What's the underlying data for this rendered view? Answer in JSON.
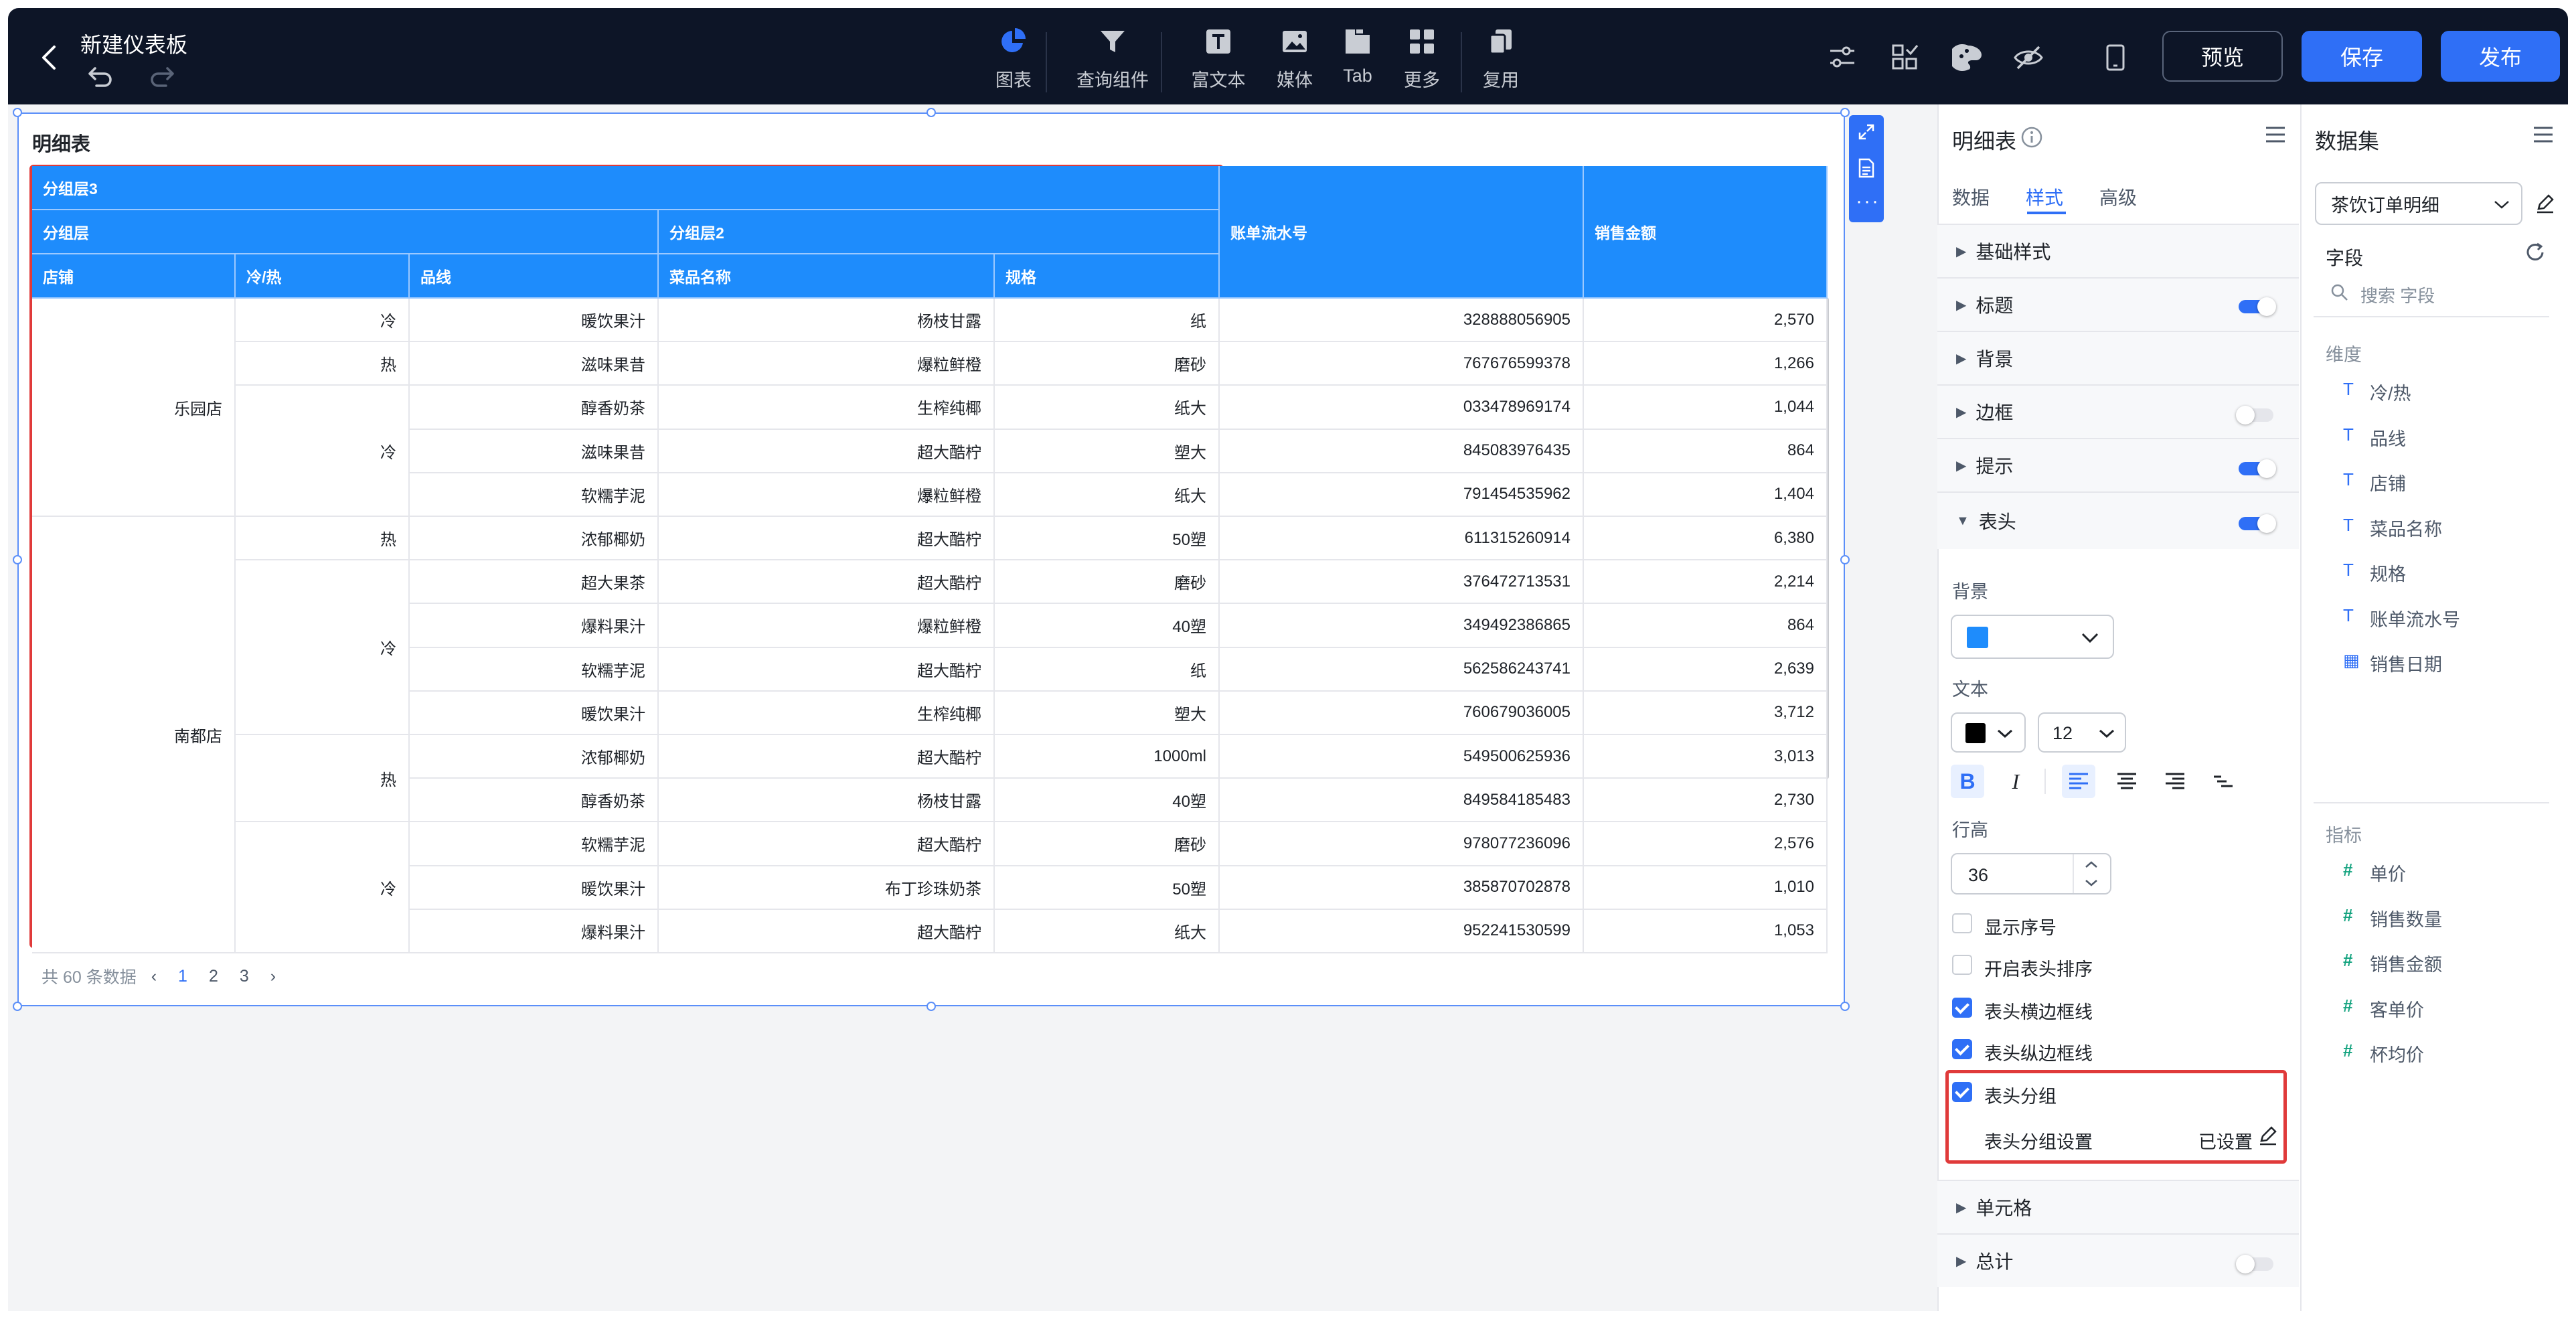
{
  "topbar": {
    "title": "新建仪表板",
    "tools": [
      {
        "label": "图表",
        "icon": "pie-chart-icon"
      },
      {
        "label": "查询组件",
        "icon": "filter-icon"
      },
      {
        "label": "富文本",
        "icon": "text-icon"
      },
      {
        "label": "媒体",
        "icon": "image-icon"
      },
      {
        "label": "Tab",
        "icon": "tab-icon"
      },
      {
        "label": "更多",
        "icon": "grid-icon"
      },
      {
        "label": "复用",
        "icon": "copy-icon"
      }
    ],
    "preview": "预览",
    "save": "保存",
    "publish": "发布",
    "accent": "#2f6ff6"
  },
  "card": {
    "title": "明细表",
    "header": {
      "group3": "分组层3",
      "group1": "分组层",
      "group2": "分组层2",
      "serial": "账单流水号",
      "amount": "销售金额",
      "cols": [
        "店铺",
        "冷/热",
        "品线",
        "菜品名称",
        "规格"
      ]
    },
    "rows": [
      [
        "乐园店",
        "冷",
        "暖饮果汁",
        "杨枝甘露",
        "纸",
        "328888056905",
        "2,570"
      ],
      [
        "",
        "热",
        "滋味果昔",
        "爆粒鲜橙",
        "磨砂",
        "767676599378",
        "1,266"
      ],
      [
        "",
        "冷",
        "醇香奶茶",
        "生榨纯椰",
        "纸大",
        "033478969174",
        "1,044"
      ],
      [
        "",
        "",
        "滋味果昔",
        "超大酷柠",
        "塑大",
        "845083976435",
        "864"
      ],
      [
        "",
        "",
        "软糯芋泥",
        "爆粒鲜橙",
        "纸大",
        "791454535962",
        "1,404"
      ],
      [
        "南都店",
        "热",
        "浓郁椰奶",
        "超大酷柠",
        "50塑",
        "611315260914",
        "6,380"
      ],
      [
        "",
        "冷",
        "超大果茶",
        "超大酷柠",
        "磨砂",
        "376472713531",
        "2,214"
      ],
      [
        "",
        "",
        "爆料果汁",
        "爆粒鲜橙",
        "40塑",
        "349492386865",
        "864"
      ],
      [
        "",
        "",
        "软糯芋泥",
        "超大酷柠",
        "纸",
        "562586243741",
        "2,639"
      ],
      [
        "",
        "",
        "暖饮果汁",
        "生榨纯椰",
        "塑大",
        "760679036005",
        "3,712"
      ],
      [
        "",
        "热",
        "浓郁椰奶",
        "超大酷柠",
        "1000ml",
        "549500625936",
        "3,013"
      ],
      [
        "",
        "",
        "醇香奶茶",
        "杨枝甘露",
        "40塑",
        "849584185483",
        "2,730"
      ],
      [
        "",
        "冷",
        "软糯芋泥",
        "超大酷柠",
        "磨砂",
        "978077236096",
        "2,576"
      ],
      [
        "",
        "",
        "暖饮果汁",
        "布丁珍珠奶茶",
        "50塑",
        "385870702878",
        "1,010"
      ],
      [
        "",
        "",
        "爆料果汁",
        "超大酷柠",
        "纸大",
        "952241530599",
        "1,053"
      ]
    ],
    "header_color": "#1e8cfc",
    "pager": {
      "total": "共 60 条数据",
      "pages": [
        "1",
        "2",
        "3"
      ]
    }
  },
  "style_panel": {
    "title": "明细表",
    "tabs": [
      "数据",
      "样式",
      "高级"
    ],
    "sections": [
      "基础样式",
      "标题",
      "背景",
      "边框",
      "提示",
      "表头"
    ],
    "header_settings": {
      "bg_label": "背景",
      "bg_color": "#1e8cfc",
      "text_label": "文本",
      "font_size": "12",
      "row_height_label": "行高",
      "row_height": "36",
      "checks": [
        {
          "label": "显示序号",
          "checked": false
        },
        {
          "label": "开启表头排序",
          "checked": false
        },
        {
          "label": "表头横边框线",
          "checked": true
        },
        {
          "label": "表头纵边框线",
          "checked": true
        },
        {
          "label": "表头分组",
          "checked": true
        }
      ],
      "group_setting_label": "表头分组设置",
      "group_setting_value": "已设置"
    },
    "bottom_sections": [
      "单元格",
      "总计"
    ]
  },
  "dataset_panel": {
    "title": "数据集",
    "dataset": "茶饮订单明细",
    "field_label": "字段",
    "search_placeholder": "搜索 字段",
    "dim_label": "维度",
    "dims": [
      "冷/热",
      "品线",
      "店铺",
      "菜品名称",
      "规格",
      "账单流水号",
      "销售日期"
    ],
    "measure_label": "指标",
    "measures": [
      "单价",
      "销售数量",
      "销售金额",
      "客单价",
      "杯均价"
    ]
  }
}
